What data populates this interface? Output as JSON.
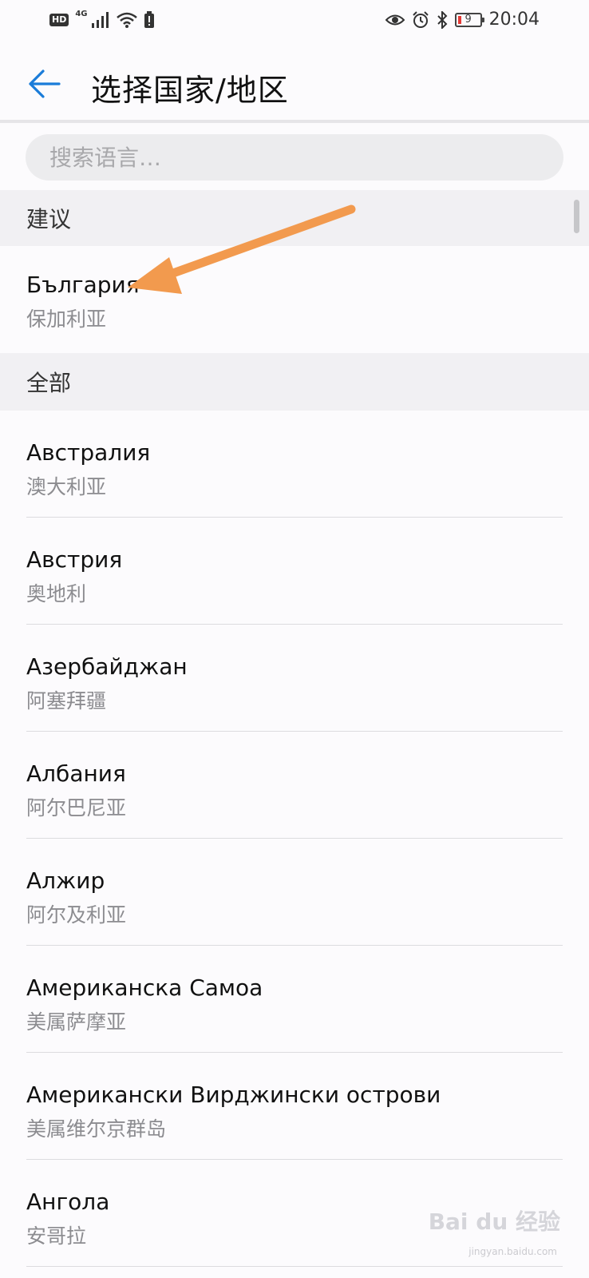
{
  "status_bar": {
    "hd": "HD",
    "network": "4G",
    "time": "20:04",
    "battery_level": "9",
    "icons": [
      "signal-icon",
      "wifi-icon",
      "warning-icon",
      "eye-comfort-icon",
      "alarm-icon",
      "bluetooth-icon",
      "battery-icon"
    ]
  },
  "header": {
    "title": "选择国家/地区",
    "back_icon": "back-arrow-icon",
    "accent_color": "#1a7cd9"
  },
  "search": {
    "placeholder": "搜索语言…"
  },
  "sections": {
    "suggested_label": "建议",
    "all_label": "全部"
  },
  "suggested": [
    {
      "name": "България",
      "sub": "保加利亚"
    }
  ],
  "countries": [
    {
      "name": "Австралия",
      "sub": "澳大利亚"
    },
    {
      "name": "Австрия",
      "sub": "奥地利"
    },
    {
      "name": "Азербайджан",
      "sub": "阿塞拜疆"
    },
    {
      "name": "Албания",
      "sub": "阿尔巴尼亚"
    },
    {
      "name": "Алжир",
      "sub": "阿尔及利亚"
    },
    {
      "name": "Американска Самоа",
      "sub": "美属萨摩亚"
    },
    {
      "name": "Американски Вирджински острови",
      "sub": "美属维尔京群岛"
    },
    {
      "name": "Ангола",
      "sub": "安哥拉"
    }
  ],
  "annotation": {
    "arrow_color": "#f29a4e"
  },
  "watermark": {
    "text": "Bai du 经验",
    "url": "jingyan.baidu.com"
  }
}
